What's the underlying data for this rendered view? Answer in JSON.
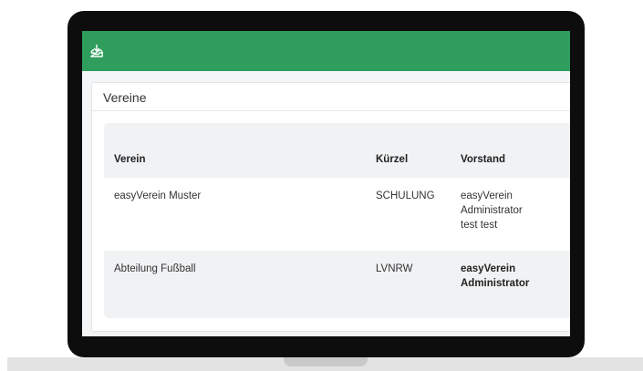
{
  "card": {
    "title": "Vereine"
  },
  "table": {
    "headers": {
      "verein": "Verein",
      "kuerzel": "Kürzel",
      "vorstand": "Vorstand"
    },
    "rows": [
      {
        "verein": "easyVerein Muster",
        "kuerzel": "SCHULUNG",
        "vorstand_line1": "easyVerein",
        "vorstand_line2": "Administrator",
        "vorstand_line3": "test test"
      },
      {
        "verein": "Abteilung Fußball",
        "kuerzel": "LVNRW",
        "vorstand_line1": "easyVerein",
        "vorstand_line2": "Administrator"
      }
    ]
  },
  "colors": {
    "appbar": "#2f9e5c",
    "bezel": "#0d0d0d"
  },
  "icons": {
    "appbar_icon": "inbox-tray-icon"
  }
}
